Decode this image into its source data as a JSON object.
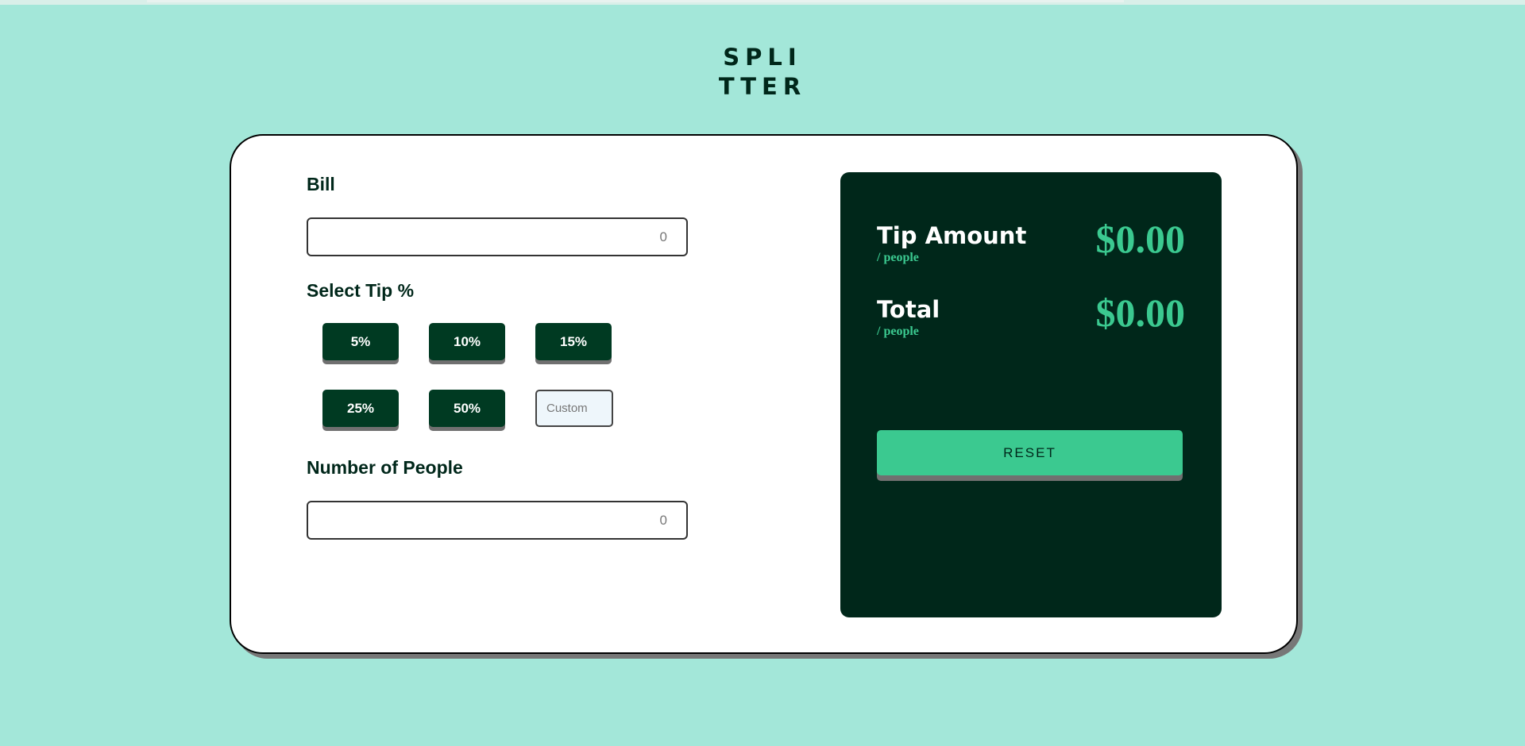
{
  "logo": {
    "line1": "SPLI",
    "line2": "TTER"
  },
  "form": {
    "bill_label": "Bill",
    "bill_placeholder": "0",
    "tip_label": "Select Tip %",
    "tip_options": [
      "5%",
      "10%",
      "15%",
      "25%",
      "50%"
    ],
    "custom_placeholder": "Custom",
    "people_label": "Number of People",
    "people_placeholder": "0"
  },
  "results": {
    "tip_title": "Tip Amount",
    "tip_sub": "/ people",
    "tip_value": "$0.00",
    "total_title": "Total",
    "total_sub": "/ people",
    "total_value": "$0.00",
    "reset_label": "RESET"
  },
  "colors": {
    "background": "#a3e7d9",
    "dark": "#00271a",
    "button": "#003a22",
    "accent": "#3bc990"
  }
}
